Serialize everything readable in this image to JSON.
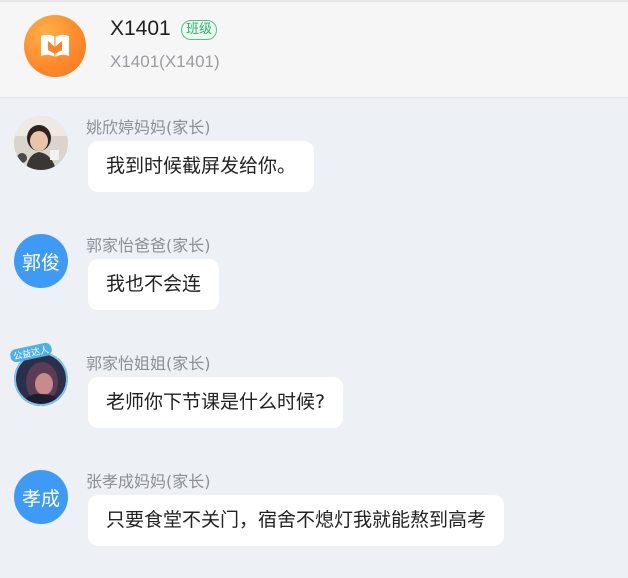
{
  "header": {
    "title": "X1401",
    "badge": "班级",
    "subtitle": "X1401(X1401)",
    "avatar_icon": "book-icon",
    "avatar_color": "#ff8a2b"
  },
  "messages": [
    {
      "sender": "姚欣婷妈妈(家长)",
      "text": "我到时候截屏发给你。",
      "avatar_type": "photo"
    },
    {
      "sender": "郭家怡爸爸(家长)",
      "text": "我也不会连",
      "avatar_type": "text",
      "avatar_text": "郭俊",
      "avatar_color": "#3d9bf5"
    },
    {
      "sender": "郭家怡姐姐(家长)",
      "text": "老师你下节课是什么时候?",
      "avatar_type": "photo",
      "avatar_tag": "公益达人"
    },
    {
      "sender": "张孝成妈妈(家长)",
      "text": "只要食堂不关门，宿舍不熄灯我就能熬到高考",
      "avatar_type": "text",
      "avatar_text": "孝成",
      "avatar_color": "#3d9bf5"
    }
  ]
}
